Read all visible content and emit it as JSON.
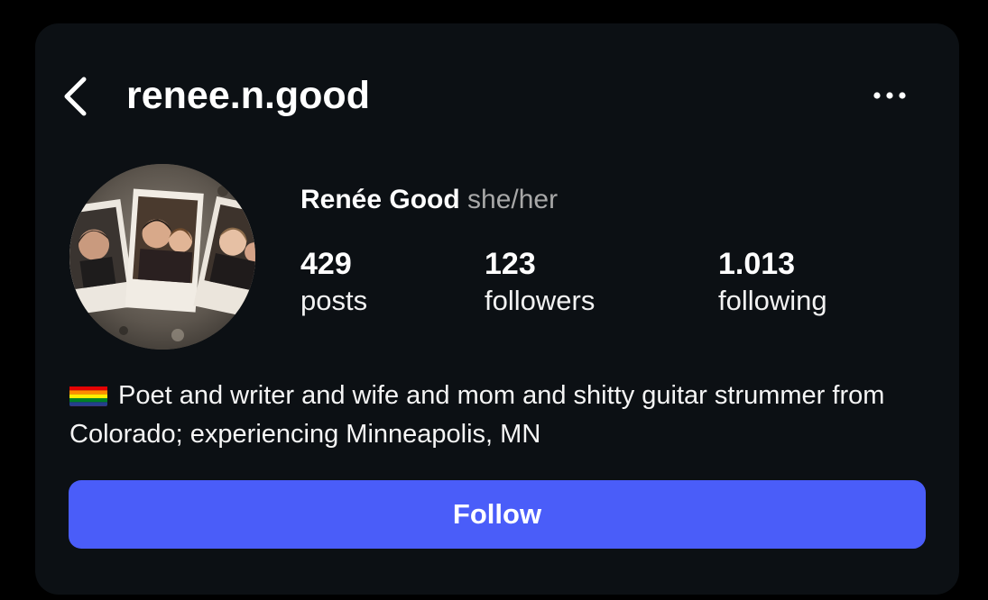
{
  "header": {
    "username": "renee.n.good",
    "back_icon": "chevron-left-icon",
    "more_icon": "more-horizontal-icon"
  },
  "profile": {
    "display_name": "Renée Good",
    "pronouns": "she/her",
    "avatar_description": "photo",
    "stats": [
      {
        "count": "429",
        "label": "posts"
      },
      {
        "count": "123",
        "label": "followers"
      },
      {
        "count": "1.013",
        "label": "following"
      }
    ],
    "bio_flag_icon": "rainbow-flag-icon",
    "bio": "Poet and writer and wife and mom and shitty guitar strummer from Colorado; experiencing Minneapolis, MN"
  },
  "actions": {
    "follow_label": "Follow"
  },
  "colors": {
    "background": "#000000",
    "card": "#0c1014",
    "accent": "#4a5df9",
    "secondary_text": "#a8a8a8"
  }
}
